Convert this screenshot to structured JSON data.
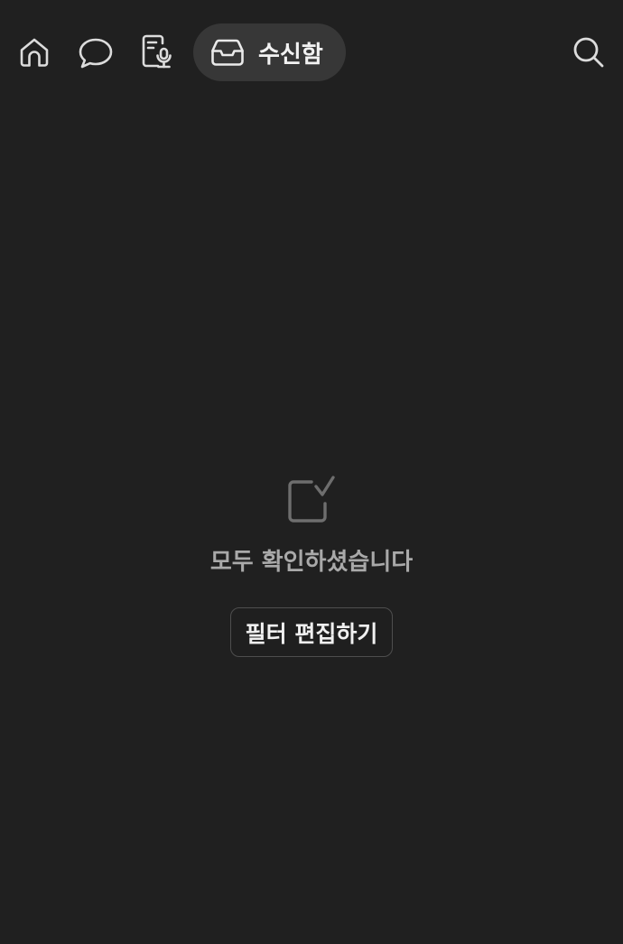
{
  "nav": {
    "items": [
      {
        "icon": "home-icon"
      },
      {
        "icon": "chat-bubble-icon"
      },
      {
        "icon": "meeting-notes-mic-icon"
      },
      {
        "icon": "inbox-tray-icon",
        "label": "수신함",
        "active": true
      }
    ],
    "search_icon": "search-icon"
  },
  "empty_state": {
    "icon": "checkbox-checked-icon",
    "message": "모두 확인하셨습니다",
    "button_label": "필터 편집하기"
  },
  "colors": {
    "background": "#202020",
    "active_pill": "#373737",
    "icon_stroke": "#dcdcdc",
    "muted_icon": "#6e6e6e",
    "muted_text": "#a9a9a9",
    "button_border": "#4e4e4e"
  }
}
